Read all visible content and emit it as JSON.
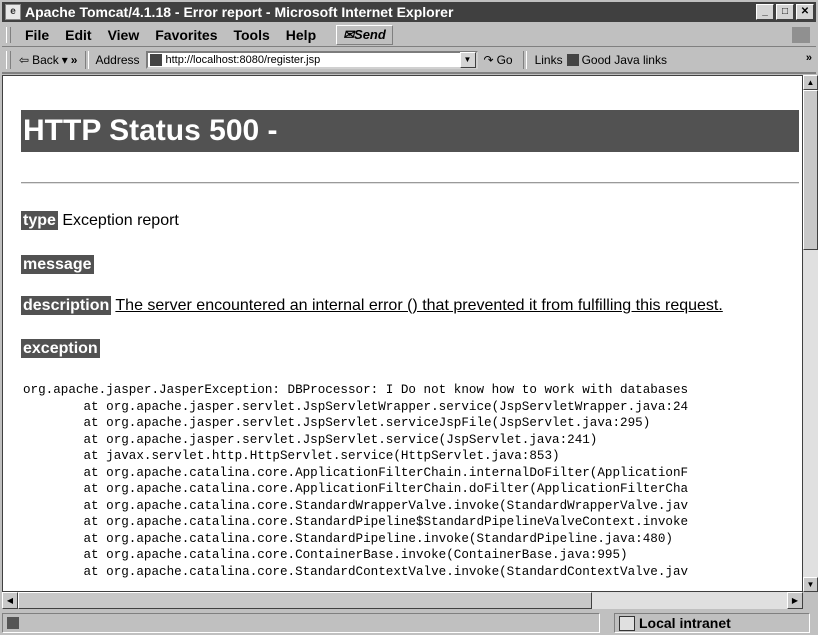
{
  "window": {
    "title": "Apache Tomcat/4.1.18 - Error report - Microsoft Internet Explorer",
    "buttons": [
      "_",
      "□",
      "✕"
    ]
  },
  "menubar": {
    "items": [
      "File",
      "Edit",
      "View",
      "Favorites",
      "Tools",
      "Help"
    ],
    "send_label": "Send"
  },
  "addressbar": {
    "back_label": "Back",
    "address_label": "Address",
    "url": "http://localhost:8080/register.jsp",
    "go_label": "Go",
    "links_label": "Links",
    "link_good_java": "Good Java links"
  },
  "page": {
    "heading": "HTTP Status 500 -",
    "type_tag": "type",
    "type_value": "Exception report",
    "message_tag": "message",
    "description_tag": "description",
    "description_value": "The server encountered an internal error () that prevented it from fulfilling this request.",
    "exception_tag": "exception",
    "stacktrace_lines": [
      "org.apache.jasper.JasperException: DBProcessor: I Do not know how to work with databases",
      "\tat org.apache.jasper.servlet.JspServletWrapper.service(JspServletWrapper.java:24",
      "\tat org.apache.jasper.servlet.JspServlet.serviceJspFile(JspServlet.java:295)",
      "\tat org.apache.jasper.servlet.JspServlet.service(JspServlet.java:241)",
      "\tat javax.servlet.http.HttpServlet.service(HttpServlet.java:853)",
      "\tat org.apache.catalina.core.ApplicationFilterChain.internalDoFilter(ApplicationF",
      "\tat org.apache.catalina.core.ApplicationFilterChain.doFilter(ApplicationFilterCha",
      "\tat org.apache.catalina.core.StandardWrapperValve.invoke(StandardWrapperValve.jav",
      "\tat org.apache.catalina.core.StandardPipeline$StandardPipelineValveContext.invoke",
      "\tat org.apache.catalina.core.StandardPipeline.invoke(StandardPipeline.java:480)",
      "\tat org.apache.catalina.core.ContainerBase.invoke(ContainerBase.java:995)",
      "\tat org.apache.catalina.core.StandardContextValve.invoke(StandardContextValve.jav"
    ]
  },
  "statusbar": {
    "zone": "Local intranet"
  },
  "icons": [
    "ie-page-icon",
    "back-arrow-icon",
    "go-arrow-icon",
    "windows-logo-icon",
    "intranet-icon"
  ],
  "colors": {
    "titlebar": "#404040",
    "tag_bg": "#525252",
    "chrome": "#c0c0c0"
  }
}
